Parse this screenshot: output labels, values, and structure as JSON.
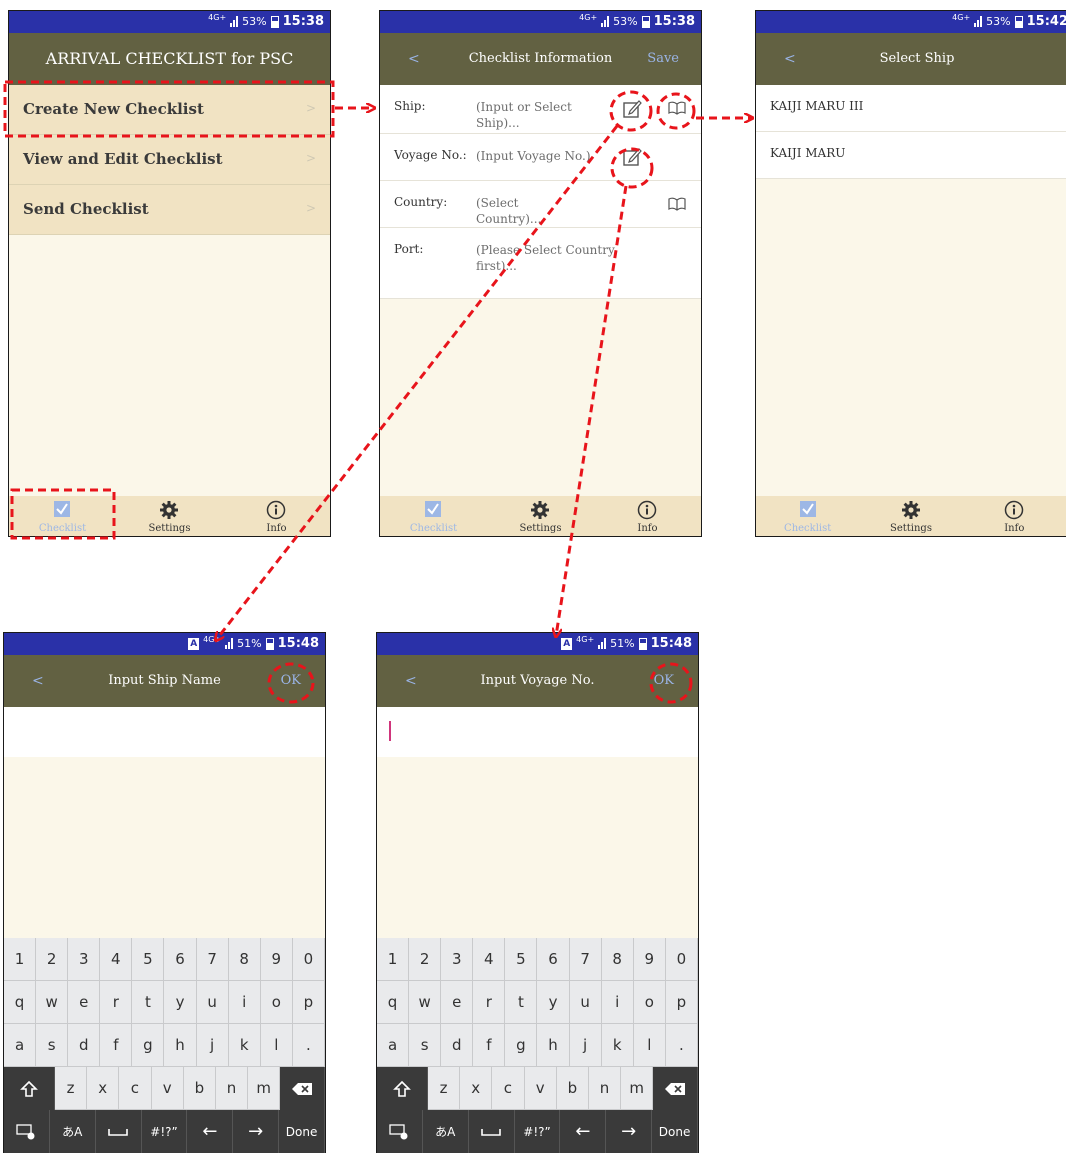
{
  "status": {
    "network": "4G+",
    "ime": "A",
    "battery_a": "53%",
    "battery_b": "51%",
    "time_1": "15:38",
    "time_2": "15:38",
    "time_3": "15:42",
    "time_4": "15:48",
    "time_5": "15:48"
  },
  "screen1": {
    "title": "ARRIVAL CHECKLIST for PSC",
    "menu": [
      {
        "label": "Create New Checklist",
        "chevron": ">"
      },
      {
        "label": "View and Edit Checklist",
        "chevron": ">"
      },
      {
        "label": "Send Checklist",
        "chevron": ">"
      }
    ]
  },
  "screen2": {
    "back": "<",
    "title": "Checklist Information",
    "save": "Save",
    "fields": [
      {
        "label": "Ship:",
        "value": "(Input or Select Ship)..."
      },
      {
        "label": "Voyage No.:",
        "value": "(Input Voyage No.)"
      },
      {
        "label": "Country:",
        "value": "(Select Country)..."
      },
      {
        "label": "Port:",
        "value": "(Please Select Country first)..."
      }
    ]
  },
  "screen3": {
    "back": "<",
    "title": "Select Ship",
    "ships": [
      "KAIJI MARU III",
      "KAIJI MARU"
    ]
  },
  "screen4": {
    "back": "<",
    "title": "Input Ship Name",
    "ok": "OK",
    "value": ""
  },
  "screen5": {
    "back": "<",
    "title": "Input Voyage No.",
    "ok": "OK",
    "value": ""
  },
  "tabs": [
    {
      "label": "Checklist",
      "icon": "checkbox-icon"
    },
    {
      "label": "Settings",
      "icon": "gear-icon"
    },
    {
      "label": "Info",
      "icon": "info-icon"
    }
  ],
  "keyboard": {
    "row1": [
      "1",
      "2",
      "3",
      "4",
      "5",
      "6",
      "7",
      "8",
      "9",
      "0"
    ],
    "row2": [
      "q",
      "w",
      "e",
      "r",
      "t",
      "y",
      "u",
      "i",
      "o",
      "p"
    ],
    "row3": [
      "a",
      "s",
      "d",
      "f",
      "g",
      "h",
      "j",
      "k",
      "l",
      "."
    ],
    "row4": [
      "z",
      "x",
      "c",
      "v",
      "b",
      "n",
      "m"
    ],
    "bottom": {
      "kana": "あA",
      "symbols": "#!?”",
      "left": "←",
      "right": "→",
      "done": "Done"
    }
  },
  "colors": {
    "header": "#626142",
    "statusbar": "#2a31a8",
    "menu_bg": "#f1e3c3",
    "body_bg": "#fbf7e9",
    "annotation": "#e8141b",
    "link": "#9ab4e6"
  }
}
